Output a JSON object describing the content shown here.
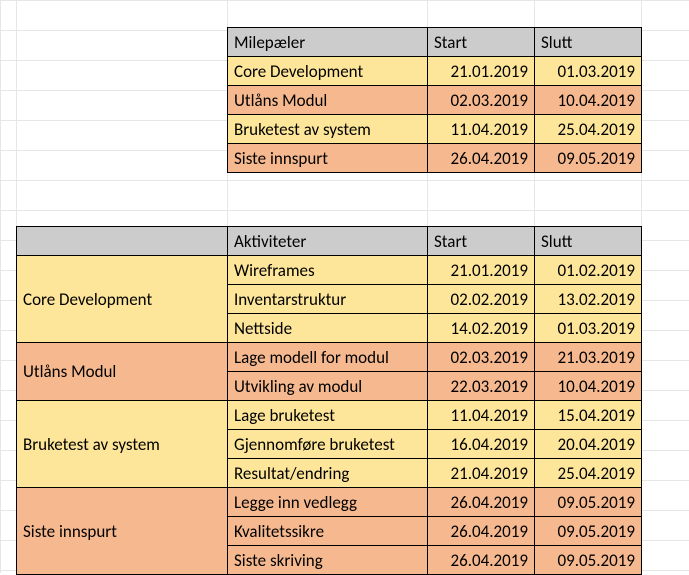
{
  "milestones": {
    "header": {
      "name": "Milepæler",
      "start": "Start",
      "end": "Slutt"
    },
    "rows": [
      {
        "name": "Core Development",
        "start": "21.01.2019",
        "end": "01.03.2019",
        "tone": "yellow"
      },
      {
        "name": "Utlåns Modul",
        "start": "02.03.2019",
        "end": "10.04.2019",
        "tone": "orange"
      },
      {
        "name": "Bruketest av system",
        "start": "11.04.2019",
        "end": "25.04.2019",
        "tone": "yellow"
      },
      {
        "name": "Siste innspurt",
        "start": "26.04.2019",
        "end": "09.05.2019",
        "tone": "orange"
      }
    ]
  },
  "activities": {
    "header": {
      "category": "",
      "name": "Aktiviteter",
      "start": "Start",
      "end": "Slutt"
    },
    "groups": [
      {
        "category": "Core Development",
        "tone": "yellow",
        "rows": [
          {
            "name": "Wireframes",
            "start": "21.01.2019",
            "end": "01.02.2019"
          },
          {
            "name": "Inventarstruktur",
            "start": "02.02.2019",
            "end": "13.02.2019"
          },
          {
            "name": "Nettside",
            "start": "14.02.2019",
            "end": "01.03.2019"
          }
        ]
      },
      {
        "category": "Utlåns Modul",
        "tone": "orange",
        "rows": [
          {
            "name": "Lage modell for modul",
            "start": "02.03.2019",
            "end": "21.03.2019"
          },
          {
            "name": "Utvikling av modul",
            "start": "22.03.2019",
            "end": "10.04.2019"
          }
        ]
      },
      {
        "category": "Bruketest av system",
        "tone": "yellow",
        "rows": [
          {
            "name": "Lage bruketest",
            "start": "11.04.2019",
            "end": "15.04.2019"
          },
          {
            "name": "Gjennomføre bruketest",
            "start": "16.04.2019",
            "end": "20.04.2019"
          },
          {
            "name": "Resultat/endring",
            "start": "21.04.2019",
            "end": "25.04.2019"
          }
        ]
      },
      {
        "category": "Siste innspurt",
        "tone": "orange",
        "rows": [
          {
            "name": "Legge inn vedlegg",
            "start": "26.04.2019",
            "end": "09.05.2019"
          },
          {
            "name": "Kvalitetssikre",
            "start": "26.04.2019",
            "end": "09.05.2019"
          },
          {
            "name": "Siste skriving",
            "start": "26.04.2019",
            "end": "09.05.2019"
          }
        ]
      }
    ]
  }
}
